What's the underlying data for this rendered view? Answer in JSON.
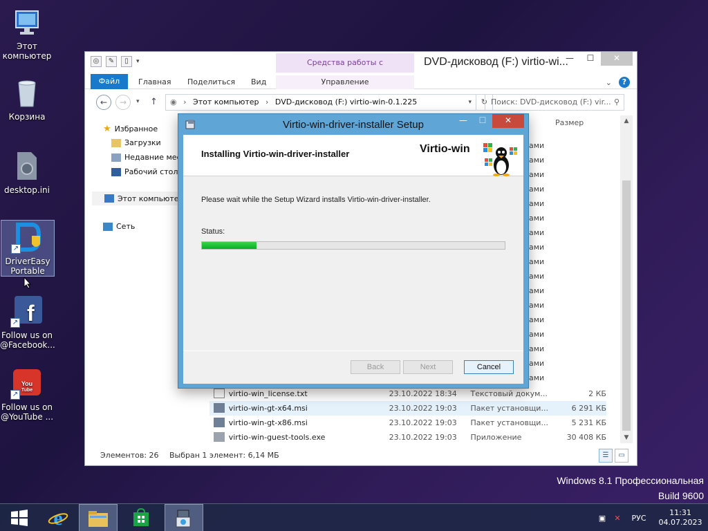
{
  "desktop": {
    "icons": [
      {
        "label": "Этот компьютер"
      },
      {
        "label": "Корзина"
      },
      {
        "label": "desktop.ini"
      },
      {
        "label": "DriverEasy Portable"
      },
      {
        "label": "Follow us on @Facebook..."
      },
      {
        "label": "Follow us on @YouTube ..."
      }
    ],
    "watermark_line1": "Windows 8.1 Профессиональная",
    "watermark_line2": "Build 9600"
  },
  "explorer": {
    "title": "DVD-дисковод (F:) virtio-wi...",
    "ribbon": {
      "file": "Файл",
      "home": "Главная",
      "share": "Поделиться",
      "view": "Вид",
      "context_header": "Средства работы с приложениями",
      "context_tab": "Управление"
    },
    "address": {
      "part1": "Этот компьютер",
      "part2": "DVD-дисковод (F:) virtio-win-0.1.225"
    },
    "search_placeholder": "Поиск: DVD-дисковод (F:) vir...",
    "nav_pane": {
      "favorites": "Избранное",
      "downloads": "Загрузки",
      "recent": "Недавние мес",
      "desktop": "Рабочий стол",
      "this_pc": "Этот компьютер",
      "network": "Сеть"
    },
    "column_size": "Размер",
    "folder_type_fragment": "ами",
    "files": [
      {
        "name": "virtio-win_license.txt",
        "date": "23.10.2022 18:34",
        "type": "Текстовый докум...",
        "size": "2 КБ"
      },
      {
        "name": "virtio-win-gt-x64.msi",
        "date": "23.10.2022 19:03",
        "type": "Пакет установщи...",
        "size": "6 291 КБ"
      },
      {
        "name": "virtio-win-gt-x86.msi",
        "date": "23.10.2022 19:03",
        "type": "Пакет установщи...",
        "size": "5 231 КБ"
      },
      {
        "name": "virtio-win-guest-tools.exe",
        "date": "23.10.2022 19:03",
        "type": "Приложение",
        "size": "30 408 КБ"
      }
    ],
    "status": {
      "items": "Элементов: 26",
      "selected": "Выбран 1 элемент: 6,14 МБ"
    }
  },
  "setup": {
    "title": "Virtio-win-driver-installer Setup",
    "heading": "Installing Virtio-win-driver-installer",
    "brand": "Virtio-win",
    "message": "Please wait while the Setup Wizard installs Virtio-win-driver-installer.",
    "status_label": "Status:",
    "progress": 0.18,
    "buttons": {
      "back": "Back",
      "next": "Next",
      "cancel": "Cancel"
    }
  },
  "taskbar": {
    "language": "РУС",
    "time": "11:31",
    "date": "04.07.2023"
  },
  "colors": {
    "accent": "#1979ca",
    "progress": "#06b025",
    "dialog_frame": "#5fa6d6"
  }
}
